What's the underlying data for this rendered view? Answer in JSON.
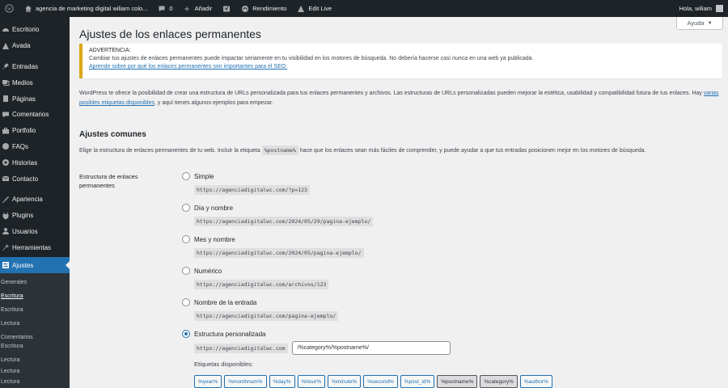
{
  "adminbar": {
    "wp_logo_icon": "wordpress-icon",
    "site_name": "agencia de marketing digital wiliam colo...",
    "comments_count": "0",
    "new_label": "Añadir",
    "plugin_label": "",
    "performance_label": "Rendimiento",
    "edit_live_label": "Edit Live",
    "greeting": "Hola, wiliam"
  },
  "sidebar": {
    "items": [
      {
        "label": "Escritorio",
        "icon": "dashboard-icon"
      },
      {
        "label": "Avada",
        "icon": "avada-icon"
      },
      {
        "label": "Entradas",
        "icon": "pin-icon"
      },
      {
        "label": "Medios",
        "icon": "media-icon"
      },
      {
        "label": "Páginas",
        "icon": "pages-icon"
      },
      {
        "label": "Comentarios",
        "icon": "comments-icon"
      },
      {
        "label": "Portfolio",
        "icon": "portfolio-icon"
      },
      {
        "label": "FAQs",
        "icon": "faq-icon"
      },
      {
        "label": "Historias",
        "icon": "stories-icon"
      },
      {
        "label": "Contacto",
        "icon": "mail-icon"
      },
      {
        "label": "Apariencia",
        "icon": "appearance-icon"
      },
      {
        "label": "Plugins",
        "icon": "plugins-icon"
      },
      {
        "label": "Usuarios",
        "icon": "users-icon"
      },
      {
        "label": "Herramientas",
        "icon": "tools-icon"
      },
      {
        "label": "Ajustes",
        "icon": "settings-icon"
      }
    ],
    "submenu": [
      "Generales",
      "Escritura",
      "Escritura",
      "Lectura",
      "Comentarios",
      "Escritura",
      "Lectura",
      "Lectura",
      "Lectura"
    ]
  },
  "help_tab": {
    "label": "Ayuda"
  },
  "page_title": "Ajustes de los enlaces permanentes",
  "notice": {
    "title": "ADVERTENCIA:",
    "body_before": "Cambiar tus ajustes de enlaces permanentes puede impactar seriamente en tu visibilidad en los motores de búsqueda. No debería hacerse ",
    "body_em1": "casi",
    "body_mid": " ",
    "body_em2": "nunca",
    "body_after": " en una web ya publicada.",
    "link": "Aprende sobre por qué los enlaces permanentes son importantes para el SEO."
  },
  "intro": {
    "text1": "WordPress te ofrece la posibilidad de crear una estructura de URLs personalizada para tus enlaces permanentes y archivos. Las estructuras de URLs personalizadas pueden mejorar la estética, usabilidad y compatibilidad futura de tus enlaces. Hay ",
    "link": "varias posibles etiquetas disponibles",
    "text2": ", y aquí tienes algunos ejemplos para empezar."
  },
  "common": {
    "title": "Ajustes comunes",
    "desc_before": "Elige la estructura de enlaces permanentes de tu web. Incluir la etiqueta ",
    "desc_code": "%postname%",
    "desc_after": " hace que los enlaces sean más fáciles de comprender, y puede ayudar a que tus entradas posicionen mejor en los motores de búsqueda."
  },
  "structure": {
    "label": "Estructura de enlaces permanentes",
    "options": [
      {
        "label": "Simple",
        "example": "https://agenciadigitalwc.com/?p=123",
        "checked": false
      },
      {
        "label": "Día y nombre",
        "example": "https://agenciadigitalwc.com/2024/05/29/pagina-ejemplo/",
        "checked": false
      },
      {
        "label": "Mes y nombre",
        "example": "https://agenciadigitalwc.com/2024/05/pagina-ejemplo/",
        "checked": false
      },
      {
        "label": "Numérico",
        "example": "https://agenciadigitalwc.com/archivos/123",
        "checked": false
      },
      {
        "label": "Nombre de la entrada",
        "example": "https://agenciadigitalwc.com/pagina-ejemplo/",
        "checked": false
      },
      {
        "label": "Estructura personalizada",
        "example": "",
        "checked": true
      }
    ],
    "custom_base": "https://agenciadigitalwc.com",
    "custom_value": "/%category%/%postname%/",
    "tags_label": "Etiquetas disponibles:",
    "tags": [
      {
        "label": "%year%",
        "active": false
      },
      {
        "label": "%monthnum%",
        "active": false
      },
      {
        "label": "%day%",
        "active": false
      },
      {
        "label": "%hour%",
        "active": false
      },
      {
        "label": "%minute%",
        "active": false
      },
      {
        "label": "%second%",
        "active": false
      },
      {
        "label": "%post_id%",
        "active": false
      },
      {
        "label": "%postname%",
        "active": true
      },
      {
        "label": "%category%",
        "active": true
      },
      {
        "label": "%author%",
        "active": false
      }
    ]
  }
}
